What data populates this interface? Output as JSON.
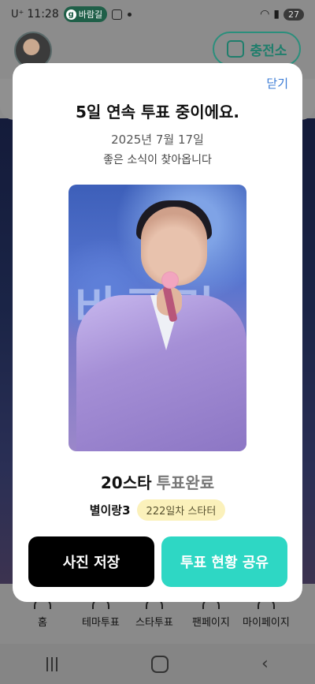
{
  "status_bar": {
    "carrier": "U⁺",
    "time": "11:28",
    "notification_badge": "바람길",
    "battery": "27"
  },
  "header": {
    "charge_button_label": "충전소"
  },
  "bottom_nav": {
    "items": [
      {
        "label": "홈"
      },
      {
        "label": "테마투표"
      },
      {
        "label": "스타투표"
      },
      {
        "label": "팬페이지"
      },
      {
        "label": "마이페이지"
      }
    ]
  },
  "modal": {
    "close_label": "닫기",
    "title": "5일 연속 투표 중이에요.",
    "date": "2025년 7월 17일",
    "subtitle": "좋은 소식이 찾아옵니다",
    "photo_stage_text": "바르미",
    "vote_count": "20스타",
    "vote_status": "투표완료",
    "user_name": "별이랑3",
    "starter_badge": "222일차 스타터",
    "save_button_label": "사진 저장",
    "share_button_label": "투표 현황 공유"
  },
  "colors": {
    "accent_teal": "#2ed7c4",
    "link_blue": "#3a7bd5",
    "badge_yellow": "#fbf1bb"
  },
  "icons": [
    "gallery-icon",
    "charge-station-icon",
    "home-icon",
    "recent-apps-icon",
    "back-icon"
  ]
}
